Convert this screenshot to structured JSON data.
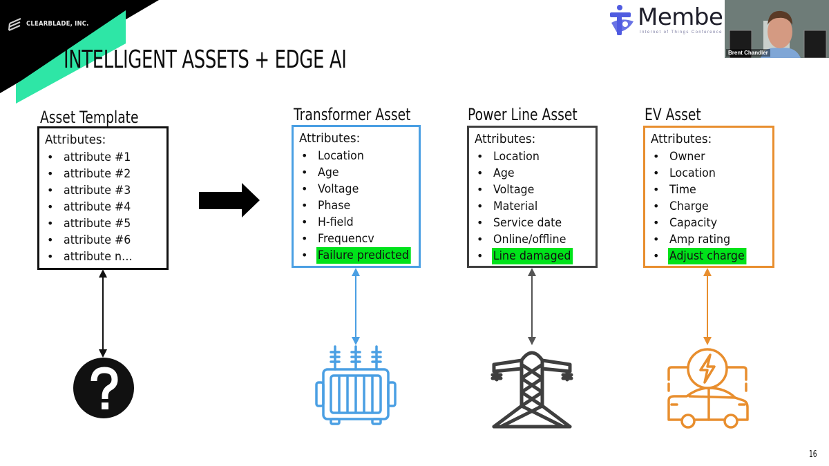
{
  "slide": {
    "company": "CLEARBLADE, INC.",
    "title": "INTELLIGENT ASSETS + EDGE AI",
    "page_number": "16",
    "colors": {
      "brand_green": "#2ee6a6",
      "highlight_green": "#00e21a",
      "template_color": "#111111",
      "transformer_color": "#4a9fe3",
      "powerline_color": "#3f3f3f",
      "ev_color": "#e88e2e"
    }
  },
  "overlay": {
    "sponsor_logo_text": "Member",
    "sponsor_logo_subtext": "Internet of Things Conference",
    "webcam_participant_name": "Brent Chandler"
  },
  "flow_arrow_icon": "right-arrow-icon",
  "assets": [
    {
      "title": "Asset Template",
      "attributes_label": "Attributes:",
      "attributes": [
        "attribute #1",
        "attribute #2",
        "attribute #3",
        "attribute #4",
        "attribute #5",
        "attribute #6",
        "attribute n…"
      ],
      "highlighted": null,
      "icon": "question-mark-icon"
    },
    {
      "title": "Transformer Asset",
      "attributes_label": "Attributes:",
      "attributes": [
        "Location",
        "Age",
        "Voltage",
        "Phase",
        "H-field",
        "Frequencv"
      ],
      "highlighted": "Failure predicted",
      "icon": "transformer-icon"
    },
    {
      "title": "Power Line Asset",
      "attributes_label": "Attributes:",
      "attributes": [
        "Location",
        "Age",
        "Voltage",
        "Material",
        "Service date",
        "Online/offline"
      ],
      "highlighted": "Line damaged",
      "icon": "power-tower-icon"
    },
    {
      "title": "EV Asset",
      "attributes_label": "Attributes:",
      "attributes": [
        "Owner",
        "Location",
        "Time",
        "Charge",
        "Capacity",
        "Amp rating"
      ],
      "highlighted": "Adjust charge",
      "icon": "ev-charging-icon"
    }
  ]
}
